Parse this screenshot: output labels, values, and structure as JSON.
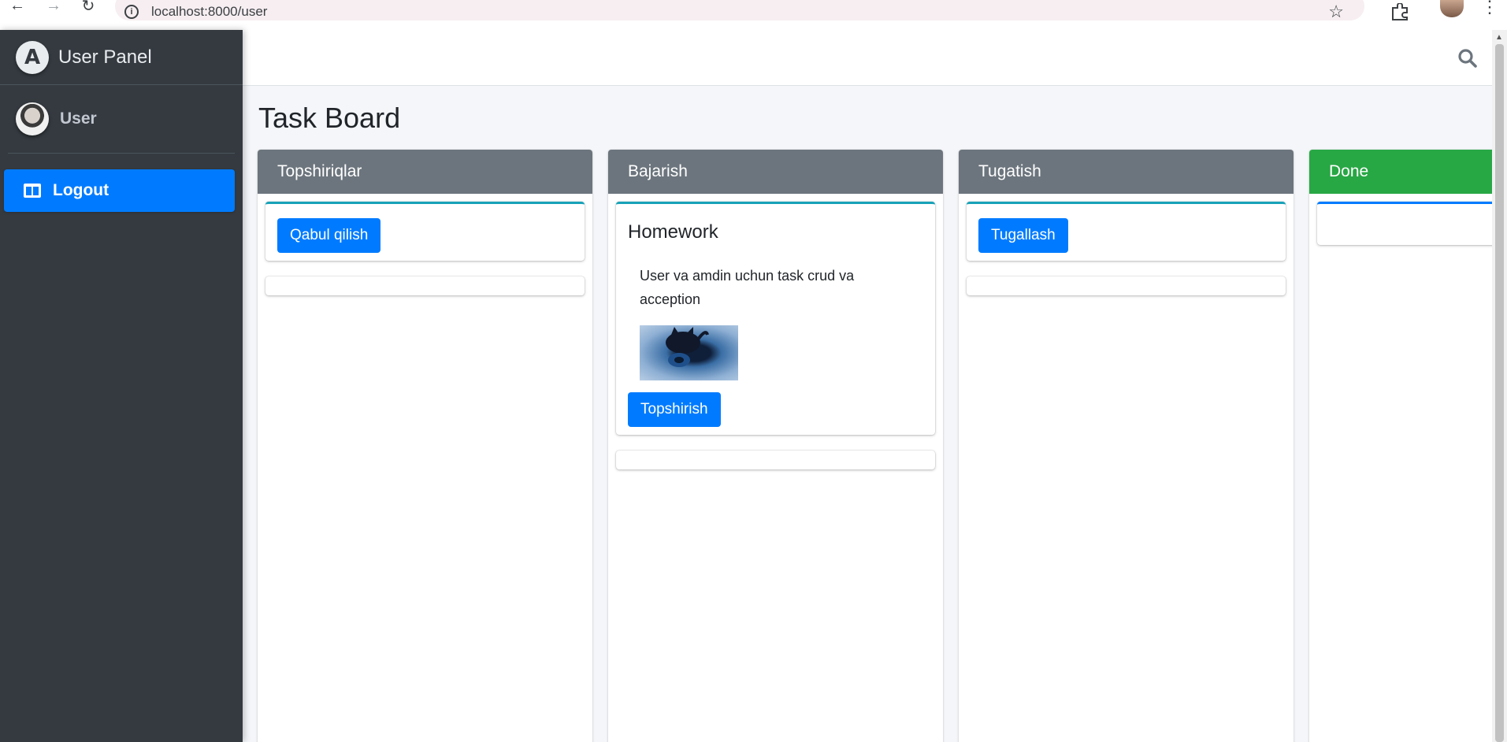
{
  "browser": {
    "url": "localhost:8000/user"
  },
  "sidebar": {
    "brand": "User Panel",
    "user_name": "User",
    "menu": [
      {
        "label": "Logout",
        "icon": "columns-icon"
      }
    ]
  },
  "page": {
    "title": "Task Board"
  },
  "columns": [
    {
      "title": "Topshiriqlar",
      "cards": [
        {
          "button": "Qabul qilish"
        }
      ]
    },
    {
      "title": "Bajarish",
      "cards": [
        {
          "title": "Homework",
          "description": "User va amdin uchun task crud va acception",
          "button": "Topshirish"
        }
      ]
    },
    {
      "title": "Tugatish",
      "cards": [
        {
          "button": "Tugallash"
        }
      ]
    },
    {
      "title": "Done",
      "header_color": "#28a745",
      "cards": []
    }
  ],
  "colors": {
    "sidebar": "#343a40",
    "primary": "#007bff",
    "column_header": "#6c757d",
    "card_border": "#17a2b8"
  }
}
